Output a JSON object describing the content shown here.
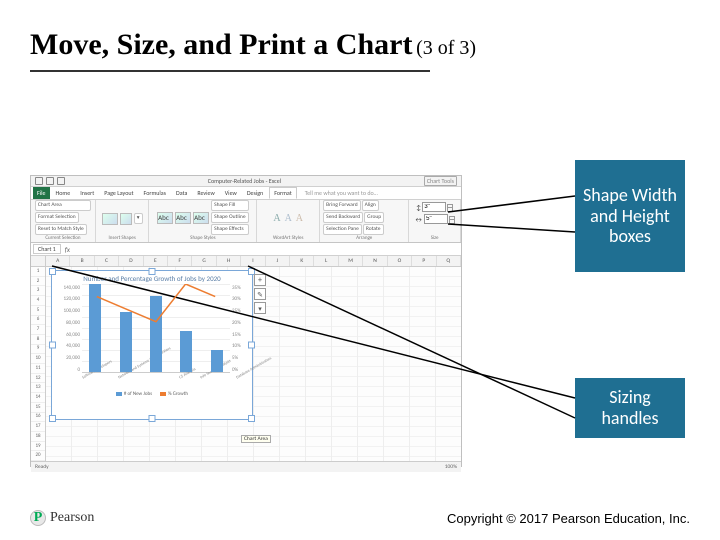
{
  "title": {
    "main": "Move, Size, and Print a Chart",
    "counter": "(3 of 3)"
  },
  "callouts": {
    "size_boxes": "Shape Width and Height boxes",
    "sizing_handles": "Sizing handles"
  },
  "footer": {
    "copyright": "Copyright © 2017 Pearson Education, Inc.",
    "brand": "Pearson",
    "brand_initial": "P"
  },
  "excel": {
    "window_title": "Computer-Related Jobs - Excel",
    "chart_tools_label": "Chart Tools",
    "tabs": [
      "File",
      "Home",
      "Insert",
      "Page Layout",
      "Formulas",
      "Data",
      "Review",
      "View",
      "Design",
      "Format"
    ],
    "tell_me": "Tell me what you want to do…",
    "groups": [
      "Current Selection",
      "Insert Shapes",
      "Shape Styles",
      "WordArt Styles",
      "Arrange",
      "Size"
    ],
    "sel_items": [
      "Chart Area",
      "Format Selection",
      "Reset to Match Style"
    ],
    "shape_fill": "Shape Fill",
    "shape_outline": "Shape Outline",
    "shape_effects": "Shape Effects",
    "arrange_items": [
      "Bring Forward",
      "Send Backward",
      "Selection Pane",
      "Align",
      "Group",
      "Rotate"
    ],
    "size": {
      "height": "3\"",
      "width": "5\""
    },
    "namebox": "Chart 1",
    "fx": "fx",
    "cols": [
      "A",
      "B",
      "C",
      "D",
      "E",
      "F",
      "G",
      "H",
      "I",
      "J",
      "K",
      "L",
      "M",
      "N",
      "O",
      "P",
      "Q"
    ],
    "rows_count": 20,
    "status": {
      "mode": "Ready",
      "zoom": "100%"
    },
    "tooltip": "Chart Area",
    "plus": "+",
    "brush": "✎",
    "filter": "▾"
  },
  "chart_data": {
    "type": "bar",
    "title": "Number and Percentage Growth of Jobs by 2020",
    "categories": [
      "Software Developers",
      "Network and Systems Administrators",
      "CS Analysts",
      "Info Security Analysts",
      "Database Administrators"
    ],
    "series": [
      {
        "name": "# of New Jobs",
        "axis": "y",
        "values": [
          140000,
          95000,
          120000,
          65000,
          35000
        ],
        "color": "#5b9bd5"
      },
      {
        "name": "% Growth",
        "axis": "y2",
        "values": [
          30,
          25,
          20,
          35,
          30
        ],
        "color": "#ed7d31"
      }
    ],
    "ylim": [
      0,
      140000
    ],
    "yticks": [
      0,
      20000,
      40000,
      60000,
      80000,
      100000,
      120000,
      140000
    ],
    "y2lim": [
      0,
      35
    ],
    "y2ticks": [
      "0%",
      "5%",
      "10%",
      "15%",
      "20%",
      "25%",
      "30%",
      "35%"
    ],
    "legend": [
      "# of New Jobs",
      "% Growth"
    ]
  }
}
